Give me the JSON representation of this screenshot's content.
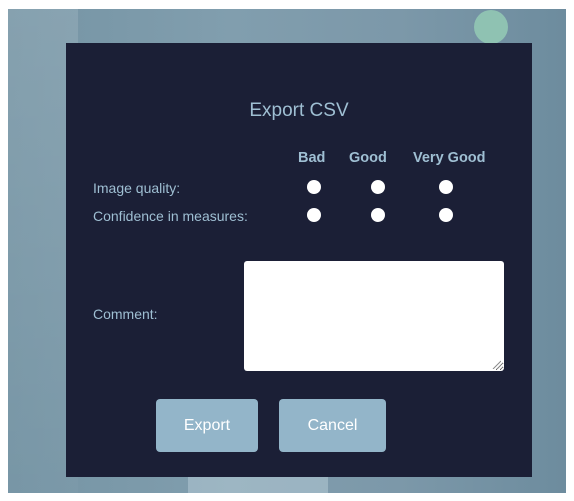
{
  "dialog": {
    "title": "Export CSV",
    "rating_columns": [
      "Bad",
      "Good",
      "Very Good"
    ],
    "rows": [
      {
        "label": "Image quality:"
      },
      {
        "label": "Confidence in measures:"
      }
    ],
    "comment": {
      "label": "Comment:",
      "value": ""
    },
    "buttons": {
      "export_label": "Export",
      "cancel_label": "Cancel"
    }
  },
  "colors": {
    "dialog_bg": "#1b1f36",
    "text_accent": "#9fbfd3",
    "button_bg": "#93b5c9",
    "backdrop": "#7c98a9",
    "deco_circle": "#8fc2b2"
  }
}
